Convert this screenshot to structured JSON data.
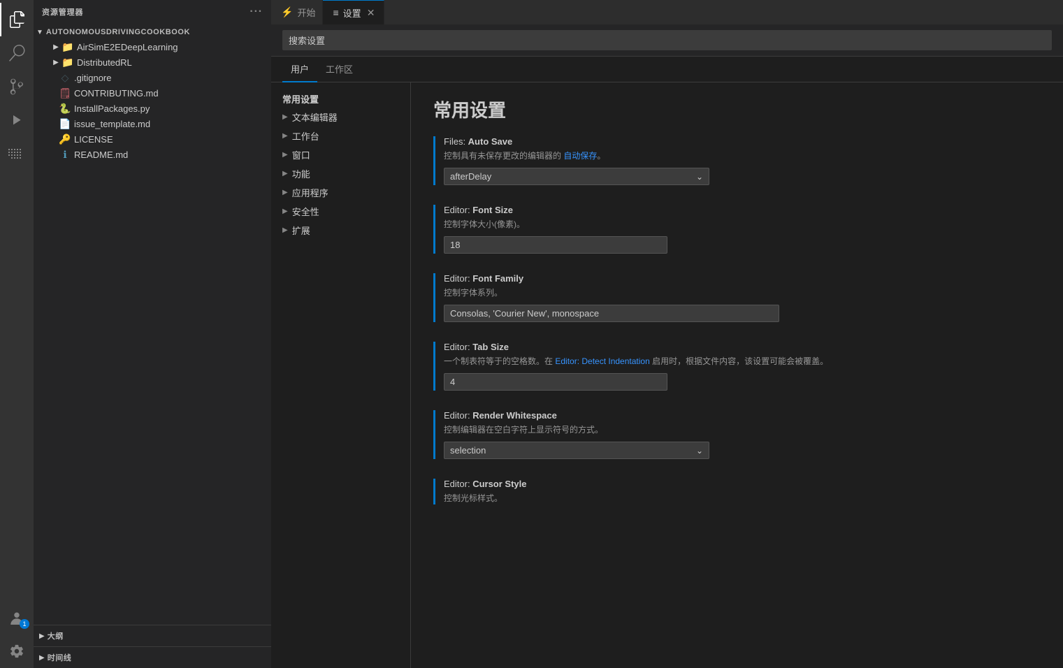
{
  "activityBar": {
    "items": [
      {
        "icon": "⊞",
        "name": "explorer-icon",
        "label": "Explorer",
        "active": false
      },
      {
        "icon": "🔍",
        "name": "search-icon",
        "label": "Search",
        "active": false
      },
      {
        "icon": "⑂",
        "name": "source-control-icon",
        "label": "Source Control",
        "active": false
      },
      {
        "icon": "▷",
        "name": "run-icon",
        "label": "Run",
        "active": false
      },
      {
        "icon": "⧉",
        "name": "extensions-icon",
        "label": "Extensions",
        "active": false
      }
    ],
    "bottomItems": [
      {
        "icon": "⚙",
        "name": "accounts-icon",
        "label": "Accounts",
        "badge": "1"
      },
      {
        "icon": "⚙",
        "name": "settings-icon",
        "label": "Settings"
      }
    ]
  },
  "sidebar": {
    "title": "资源管理器",
    "rootFolder": "AUTONOMOUSDRIVINGCOOKBOOK",
    "items": [
      {
        "type": "folder",
        "name": "AirSimE2EDeepLearning",
        "indent": 1
      },
      {
        "type": "folder",
        "name": "DistributedRL",
        "indent": 1
      },
      {
        "type": "file",
        "name": ".gitignore",
        "icon": "◇",
        "iconClass": "icon-gitignore",
        "indent": 1
      },
      {
        "type": "file",
        "name": "CONTRIBUTING.md",
        "icon": "🗒",
        "iconClass": "icon-red",
        "indent": 1
      },
      {
        "type": "file",
        "name": "InstallPackages.py",
        "icon": "🐍",
        "iconClass": "icon-blue",
        "indent": 1
      },
      {
        "type": "file",
        "name": "issue_template.md",
        "icon": "📄",
        "iconClass": "icon-yellow",
        "indent": 1
      },
      {
        "type": "file",
        "name": "LICENSE",
        "icon": "🔑",
        "iconClass": "icon-yellow",
        "indent": 1
      },
      {
        "type": "file",
        "name": "README.md",
        "icon": "ℹ",
        "iconClass": "icon-blue",
        "indent": 1
      }
    ],
    "panels": [
      {
        "label": "大纲"
      },
      {
        "label": "时间线"
      }
    ]
  },
  "tabs": [
    {
      "icon": "⚡",
      "iconColor": "#75beff",
      "label": "开始",
      "active": false,
      "closable": false
    },
    {
      "icon": "≡",
      "iconColor": "#cccccc",
      "label": "设置",
      "active": true,
      "closable": true
    }
  ],
  "searchBar": {
    "placeholder": "搜索设置"
  },
  "settingsTabs": [
    {
      "label": "用户",
      "active": true
    },
    {
      "label": "工作区",
      "active": false
    }
  ],
  "settingsNav": {
    "commonHeader": "常用设置",
    "items": [
      {
        "label": "文本编辑器",
        "hasChevron": true
      },
      {
        "label": "工作台",
        "hasChevron": true
      },
      {
        "label": "窗口",
        "hasChevron": true
      },
      {
        "label": "功能",
        "hasChevron": true
      },
      {
        "label": "应用程序",
        "hasChevron": true
      },
      {
        "label": "安全性",
        "hasChevron": true
      },
      {
        "label": "扩展",
        "hasChevron": true
      }
    ]
  },
  "settingsPanel": {
    "title": "常用设置",
    "items": [
      {
        "id": "auto-save",
        "title": "Files: ",
        "titleBold": "Auto Save",
        "desc": "控制具有未保存更改的编辑器的 {link}。",
        "link": "自动保存",
        "control": "dropdown",
        "value": "afterDelay"
      },
      {
        "id": "font-size",
        "title": "Editor: ",
        "titleBold": "Font Size",
        "desc": "控制字体大小(像素)。",
        "control": "input",
        "value": "18"
      },
      {
        "id": "font-family",
        "title": "Editor: ",
        "titleBold": "Font Family",
        "desc": "控制字体系列。",
        "control": "input-wide",
        "value": "Consolas, 'Courier New', monospace"
      },
      {
        "id": "tab-size",
        "title": "Editor: ",
        "titleBold": "Tab Size",
        "desc": "一个制表符等于的空格数。在 {link} 启用时，根据文件内容，该设置可能会被覆盖。",
        "link": "Editor: Detect Indentation",
        "control": "input",
        "value": "4"
      },
      {
        "id": "render-whitespace",
        "title": "Editor: ",
        "titleBold": "Render Whitespace",
        "desc": "控制编辑器在空白字符上显示符号的方式。",
        "control": "dropdown",
        "value": "selection"
      },
      {
        "id": "cursor-style",
        "title": "Editor: ",
        "titleBold": "Cursor Style",
        "desc": "控制光标样式。",
        "control": "none"
      }
    ]
  }
}
